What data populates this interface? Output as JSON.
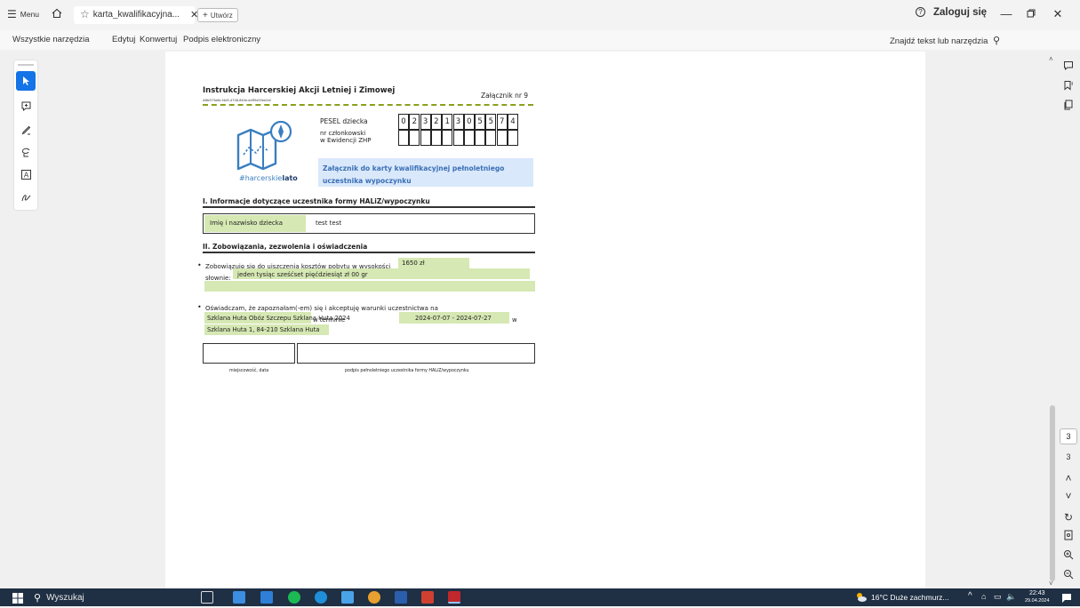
{
  "titlebar": {
    "menu_label": "Menu",
    "tab_title": "karta_kwalifikacyjna...",
    "new_tab_label": "Utwórz",
    "login_label": "Zaloguj się"
  },
  "menubar": {
    "items": [
      "Wszystkie narzędzia",
      "Edytuj",
      "Konwertuj",
      "Podpis elektroniczny"
    ],
    "search_label": "Znajdź tekst lub narzędzia"
  },
  "document": {
    "header_title": "Instrukcja Harcerskiej Akcji Letniej i Zimowej",
    "header_id": "#8b973a6e-f4d5-4748-840e-eeff5a55ee2af",
    "attachment_label": "Załącznik nr 9",
    "pesel_label": "PESEL dziecka",
    "pesel_digits": [
      "0",
      "2",
      "3",
      "2",
      "1",
      "3",
      "0",
      "5",
      "5",
      "7",
      "4"
    ],
    "member_label_1": "nr członkowski",
    "member_label_2": "w Ewidencji ZHP",
    "logo_hashtag_1": "#harcerskie",
    "logo_hashtag_2": "lato",
    "annex_title_1": "Załącznik do karty kwalifikacyjnej pełnoletniego",
    "annex_title_2": "uczestnika wypoczynku",
    "section1_title": "I. Informacje dotyczące uczestnika formy HALiZ/wypoczynku",
    "name_label": "Imię i nazwisko dziecka",
    "name_value": "test test",
    "section2_title": "II. Zobowiązania, zezwolenia i oświadczenia",
    "cost_text": "Zobowiązuję się do uiszczenia kosztów pobytu w wysokości",
    "cost_value": "1650 zł",
    "words_label": "słownie:",
    "words_value": "jeden tysiąc sześćset pięćdziesiąt zł 00 gr",
    "statement_text": "Oświadczam, że zapoznałam(-em) się i akceptuję warunki uczestnictwa na",
    "camp_name": "Szklana Huta Obóz Szczepu Szklana Huta 2024",
    "term_label": "w terminie",
    "term_value": "2024-07-07 - 2024-07-27",
    "w_label": "w",
    "camp_address": "Szklana Huta 1, 84-210 Szklana Huta",
    "sig_place_label": "miejscowość, data",
    "sig_signature_label": "podpis pełnoletniego uczestnika formy HALiZ/wypoczynku"
  },
  "sidebar_right": {
    "page_current": "3",
    "page_total": "3"
  },
  "taskbar": {
    "search_placeholder": "Wyszukaj",
    "weather": "16°C  Duże zachmurz...",
    "time": "22:43",
    "date": "29.04.2024"
  },
  "colors": {
    "accent": "#1473e6",
    "field_green": "#d6e8b3",
    "annex_blue": "#d9e8fb",
    "dashed_green": "#8aa01a",
    "logo_blue": "#3a7ec0"
  }
}
